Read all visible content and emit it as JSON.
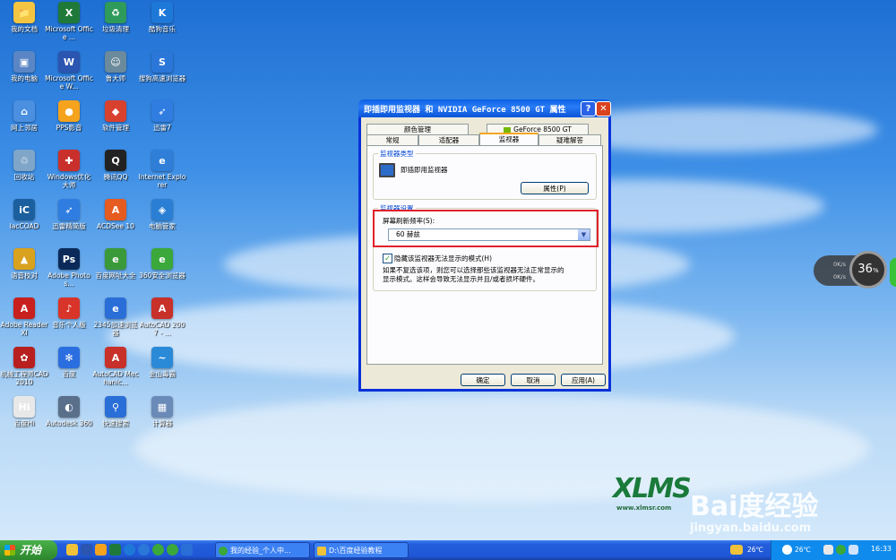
{
  "desktop_icons": [
    {
      "label": "我的文档",
      "color": "#f4c542",
      "glyph": "📁"
    },
    {
      "label": "Microsoft Office ...",
      "color": "#1f7a3a",
      "glyph": "X"
    },
    {
      "label": "垃圾清理",
      "color": "#2e9b5a",
      "glyph": "♻"
    },
    {
      "label": "酷狗音乐",
      "color": "#1e78d8",
      "glyph": "K"
    },
    {
      "label": "我的电脑",
      "color": "#5b86c5",
      "glyph": "▣"
    },
    {
      "label": "Microsoft Office W...",
      "color": "#2a55b0",
      "glyph": "W"
    },
    {
      "label": "鲁大师",
      "color": "#6b8a9b",
      "glyph": "☺"
    },
    {
      "label": "搜狗高速浏览器",
      "color": "#2b76d9",
      "glyph": "S"
    },
    {
      "label": "网上邻居",
      "color": "#4a8fe0",
      "glyph": "⌂"
    },
    {
      "label": "PPS影音",
      "color": "#f5a21d",
      "glyph": "●"
    },
    {
      "label": "软件管理",
      "color": "#d9412f",
      "glyph": "◆"
    },
    {
      "label": "迅雷7",
      "color": "#2f7de1",
      "glyph": "➶"
    },
    {
      "label": "回收站",
      "color": "#7fa6c8",
      "glyph": "♲"
    },
    {
      "label": "Windows优化大师",
      "color": "#c9302c",
      "glyph": "✚"
    },
    {
      "label": "腾讯QQ",
      "color": "#222222",
      "glyph": "Q"
    },
    {
      "label": "Internet Explorer",
      "color": "#2f7fd8",
      "glyph": "e"
    },
    {
      "label": "IacCOAD",
      "color": "#1b5f9e",
      "glyph": "iC"
    },
    {
      "label": "迅雷精简版",
      "color": "#2f7de1",
      "glyph": "➶"
    },
    {
      "label": "ACDSee 10",
      "color": "#e65b20",
      "glyph": "A"
    },
    {
      "label": "电脑管家",
      "color": "#2a7fd4",
      "glyph": "◈"
    },
    {
      "label": "语音校对",
      "color": "#d8a21e",
      "glyph": "▲"
    },
    {
      "label": "Adobe Photos...",
      "color": "#0b2a5a",
      "glyph": "Ps"
    },
    {
      "label": "百度网址大全",
      "color": "#3a9a3a",
      "glyph": "e"
    },
    {
      "label": "360安全浏览器",
      "color": "#3aa83a",
      "glyph": "e"
    },
    {
      "label": "Adobe Reader XI",
      "color": "#c8201e",
      "glyph": "A"
    },
    {
      "label": "音乐个人版",
      "color": "#d8342a",
      "glyph": "♪"
    },
    {
      "label": "2345加速浏览器",
      "color": "#2a6ed8",
      "glyph": "e"
    },
    {
      "label": "AutoCAD 2007 - ...",
      "color": "#c8302a",
      "glyph": "A"
    },
    {
      "label": "机械工程师CAD2010",
      "color": "#b82020",
      "glyph": "✿"
    },
    {
      "label": "百度",
      "color": "#2b6ee0",
      "glyph": "✻"
    },
    {
      "label": "AutoCAD Mechanic...",
      "color": "#c8302a",
      "glyph": "A"
    },
    {
      "label": "金山毒霸",
      "color": "#2b8ad8",
      "glyph": "~"
    },
    {
      "label": "百度Hi",
      "color": "#e8e8e8",
      "glyph": "Hi"
    },
    {
      "label": "Autodesk 360",
      "color": "#5a6f8a",
      "glyph": "◐"
    },
    {
      "label": "快速搜索",
      "color": "#2a6ed8",
      "glyph": "⚲"
    },
    {
      "label": "计算器",
      "color": "#6a8ab8",
      "glyph": "▦"
    }
  ],
  "dialog": {
    "title": "即插即用监视器 和 NVIDIA GeForce 8500 GT 属性",
    "help_label": "?",
    "close_label": "✕",
    "tabs_row1": [
      "颜色管理",
      "GeForce 8500 GT"
    ],
    "tabs_row2": [
      "常规",
      "适配器",
      "监视器",
      "疑难解答"
    ],
    "active_tab": "监视器",
    "monitor_type": {
      "group_label": "监视器类型",
      "monitor_name": "即插即用监视器",
      "properties_button": "属性(P)"
    },
    "monitor_settings": {
      "group_label": "监视器设置",
      "refresh_label": "屏幕刷新频率(S):",
      "refresh_value": "60 赫兹",
      "hide_modes_checked": true,
      "hide_modes_label": "隐藏该监视器无法显示的模式(H)",
      "description_line1": "如果不复选该项，则您可以选择那些该监视器无法正常显示的",
      "description_line2": "显示模式。这样会导致无法显示并且/或者损坏硬件。"
    },
    "buttons": {
      "ok": "确定",
      "cancel": "取消",
      "apply": "应用(A)"
    }
  },
  "widget": {
    "percent": "36",
    "percent_unit": "%",
    "up": "0K/s",
    "down": "0K/s"
  },
  "watermark": {
    "logo": "XLMS",
    "site": "www.xlmsr.com",
    "brand": "Bai度经验",
    "url": "jingyan.baidu.com"
  },
  "taskbar": {
    "start_label": "开始",
    "tasks": [
      "我的经验_个人中...",
      "D:\\百度经验教程"
    ],
    "tray_weather1": "26℃",
    "tray_weather2": "26℃",
    "clock": "16:33"
  }
}
